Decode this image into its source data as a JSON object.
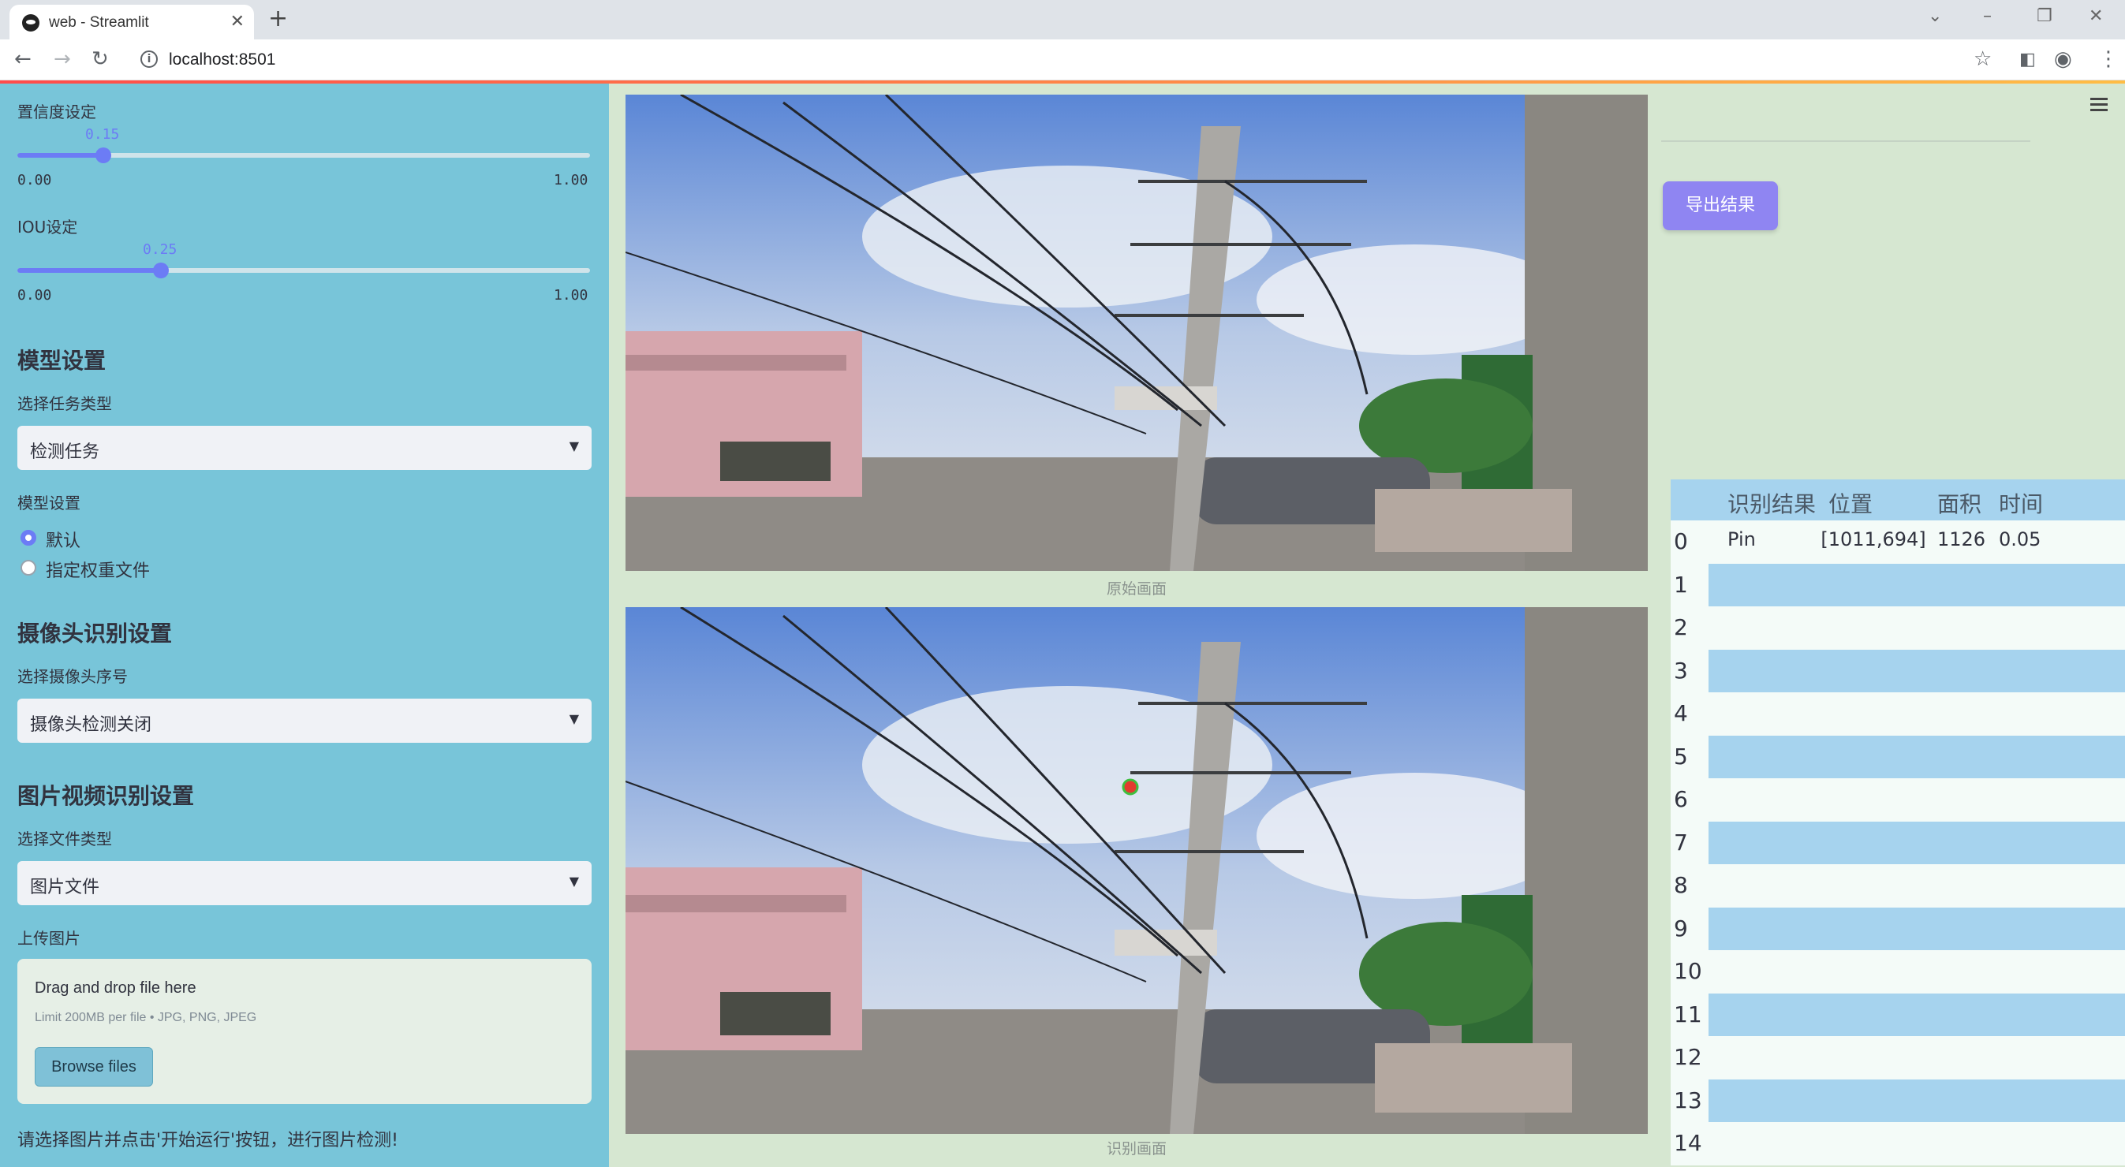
{
  "browser": {
    "tab_title": "web - Streamlit",
    "url": "localhost:8501"
  },
  "sidebar": {
    "confidence_label": "置信度设定",
    "confidence_value": "0.15",
    "confidence_fraction": 0.15,
    "confidence_min": "0.00",
    "confidence_max": "1.00",
    "iou_label": "IOU设定",
    "iou_value": "0.25",
    "iou_fraction": 0.25,
    "iou_min": "0.00",
    "iou_max": "1.00",
    "model_heading": "模型设置",
    "task_label": "选择任务类型",
    "task_value": "检测任务",
    "model_label": "模型设置",
    "radio_default": "默认",
    "radio_weights": "指定权重文件",
    "camera_heading": "摄像头识别设置",
    "camera_label": "选择摄像头序号",
    "camera_value": "摄像头检测关闭",
    "media_heading": "图片视频识别设置",
    "file_type_label": "选择文件类型",
    "file_type_value": "图片文件",
    "upload_label": "上传图片",
    "upload_main": "Drag and drop file here",
    "upload_sub": "Limit 200MB per file • JPG, PNG, JPEG",
    "browse_label": "Browse files",
    "status_text": "请选择图片并点击'开始运行'按钮，进行图片检测!"
  },
  "main": {
    "caption_original": "原始画面",
    "caption_detected": "识别画面"
  },
  "right": {
    "export_label": "导出结果",
    "table": {
      "headers": [
        "",
        "识别结果",
        "位置",
        "面积",
        "时间"
      ],
      "rows": [
        {
          "idx": "0",
          "result": "Pin",
          "pos": "[1011,694]",
          "area": "1126",
          "time": "0.05"
        },
        {
          "idx": "1",
          "result": "",
          "pos": "",
          "area": "",
          "time": ""
        },
        {
          "idx": "2",
          "result": "",
          "pos": "",
          "area": "",
          "time": ""
        },
        {
          "idx": "3",
          "result": "",
          "pos": "",
          "area": "",
          "time": ""
        },
        {
          "idx": "4",
          "result": "",
          "pos": "",
          "area": "",
          "time": ""
        },
        {
          "idx": "5",
          "result": "",
          "pos": "",
          "area": "",
          "time": ""
        },
        {
          "idx": "6",
          "result": "",
          "pos": "",
          "area": "",
          "time": ""
        },
        {
          "idx": "7",
          "result": "",
          "pos": "",
          "area": "",
          "time": ""
        },
        {
          "idx": "8",
          "result": "",
          "pos": "",
          "area": "",
          "time": ""
        },
        {
          "idx": "9",
          "result": "",
          "pos": "",
          "area": "",
          "time": ""
        },
        {
          "idx": "10",
          "result": "",
          "pos": "",
          "area": "",
          "time": ""
        },
        {
          "idx": "11",
          "result": "",
          "pos": "",
          "area": "",
          "time": ""
        },
        {
          "idx": "12",
          "result": "",
          "pos": "",
          "area": "",
          "time": ""
        },
        {
          "idx": "13",
          "result": "",
          "pos": "",
          "area": "",
          "time": ""
        },
        {
          "idx": "14",
          "result": "",
          "pos": "",
          "area": "",
          "time": ""
        }
      ]
    }
  },
  "colors": {
    "sidebar_bg": "#78c5d9",
    "main_bg": "#d6e7d1",
    "accent": "#6c7cf5",
    "export_button": "#8f85f2"
  }
}
